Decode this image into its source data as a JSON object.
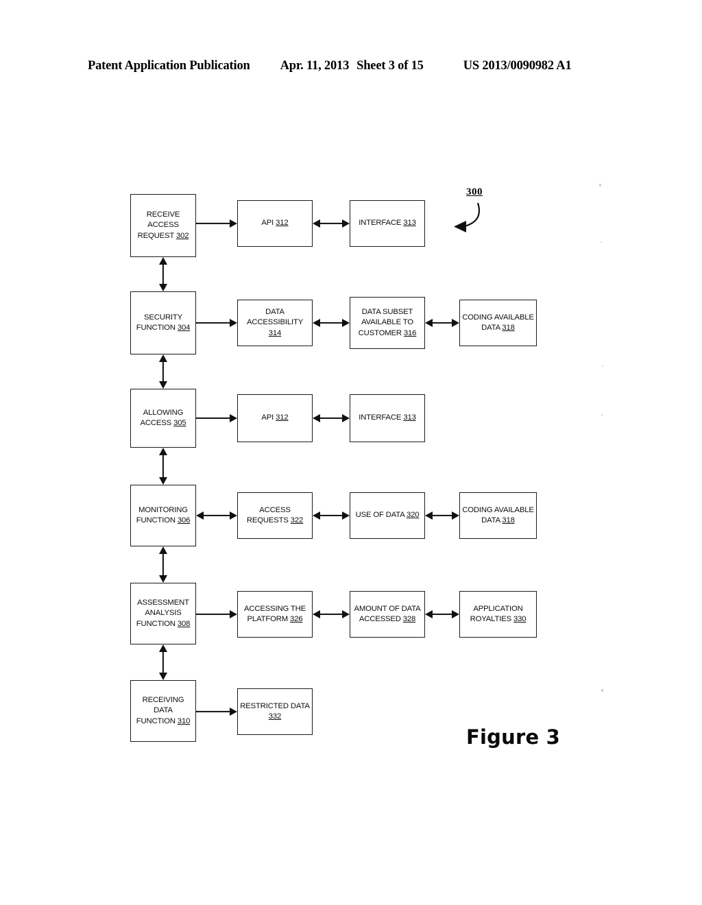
{
  "header": {
    "publication": "Patent Application Publication",
    "date": "Apr. 11, 2013",
    "sheet": "Sheet 3 of 15",
    "patent_number": "US 2013/0090982 A1"
  },
  "figure": {
    "caption": "Figure 3",
    "reference_numeral": "300"
  },
  "diagram": {
    "type": "flowchart",
    "rows": [
      {
        "nodes": [
          {
            "label": "RECEIVE ACCESS REQUEST",
            "ref": "302"
          },
          {
            "label": "API",
            "ref": "312"
          },
          {
            "label": "INTERFACE",
            "ref": "313"
          }
        ]
      },
      {
        "nodes": [
          {
            "label": "SECURITY FUNCTION",
            "ref": "304"
          },
          {
            "label": "DATA ACCESSIBILITY",
            "ref": "314"
          },
          {
            "label": "DATA SUBSET AVAILABLE TO CUSTOMER",
            "ref": "316"
          },
          {
            "label": "CODING AVAILABLE DATA",
            "ref": "318"
          }
        ]
      },
      {
        "nodes": [
          {
            "label": "ALLOWING ACCESS",
            "ref": "305"
          },
          {
            "label": "API",
            "ref": "312"
          },
          {
            "label": "INTERFACE",
            "ref": "313"
          }
        ]
      },
      {
        "nodes": [
          {
            "label": "MONITORING FUNCTION",
            "ref": "306"
          },
          {
            "label": "ACCESS REQUESTS",
            "ref": "322"
          },
          {
            "label": "USE OF DATA",
            "ref": "320"
          },
          {
            "label": "CODING AVAILABLE DATA",
            "ref": "318"
          }
        ]
      },
      {
        "nodes": [
          {
            "label": "ASSESSMENT ANALYSIS FUNCTION",
            "ref": "308"
          },
          {
            "label": "ACCESSING THE PLATFORM",
            "ref": "326"
          },
          {
            "label": "AMOUNT OF DATA ACCESSED",
            "ref": "328"
          },
          {
            "label": "APPLICATION ROYALTIES",
            "ref": "330"
          }
        ]
      },
      {
        "nodes": [
          {
            "label": "RECEIVING DATA FUNCTION",
            "ref": "310"
          },
          {
            "label": "RESTRICTED DATA",
            "ref": "332"
          }
        ]
      }
    ],
    "node_text": {
      "n302_l1": "RECEIVE",
      "n302_l2": "ACCESS",
      "n302_l3": "REQUEST",
      "n302_ref": "302",
      "n312a_l1": "API",
      "n312a_ref": "312",
      "n313a_l1": "INTERFACE",
      "n313a_ref": "313",
      "n304_l1": "SECURITY",
      "n304_l2": "FUNCTION",
      "n304_ref": "304",
      "n314_l1": "DATA",
      "n314_l2": "ACCESSIBILITY",
      "n314_ref": "314",
      "n316_l1": "DATA SUBSET",
      "n316_l2": "AVAILABLE TO",
      "n316_l3": "CUSTOMER",
      "n316_ref": "316",
      "n318a_l1": "CODING AVAILABLE",
      "n318a_l2": "DATA",
      "n318a_ref": "318",
      "n305_l1": "ALLOWING",
      "n305_l2": "ACCESS",
      "n305_ref": "305",
      "n312b_l1": "API",
      "n312b_ref": "312",
      "n313b_l1": "INTERFACE",
      "n313b_ref": "313",
      "n306_l1": "MONITORING",
      "n306_l2": "FUNCTION",
      "n306_ref": "306",
      "n322_l1": "ACCESS",
      "n322_l2": "REQUESTS",
      "n322_ref": "322",
      "n320_l1": "USE OF DATA",
      "n320_ref": "320",
      "n318b_l1": "CODING AVAILABLE",
      "n318b_l2": "DATA",
      "n318b_ref": "318",
      "n308_l1": "ASSESSMENT",
      "n308_l2": "ANALYSIS",
      "n308_l3": "FUNCTION",
      "n308_ref": "308",
      "n326_l1": "ACCESSING THE",
      "n326_l2": "PLATFORM",
      "n326_ref": "326",
      "n328_l1": "AMOUNT OF DATA",
      "n328_l2": "ACCESSED",
      "n328_ref": "328",
      "n330_l1": "APPLICATION",
      "n330_l2": "ROYALTIES",
      "n330_ref": "330",
      "n310_l1": "RECEIVING",
      "n310_l2": "DATA",
      "n310_l3": "FUNCTION",
      "n310_ref": "310",
      "n332_l1": "RESTRICTED DATA",
      "n332_ref": "332"
    }
  },
  "colors": {
    "ink": "#111111",
    "page": "#ffffff"
  }
}
